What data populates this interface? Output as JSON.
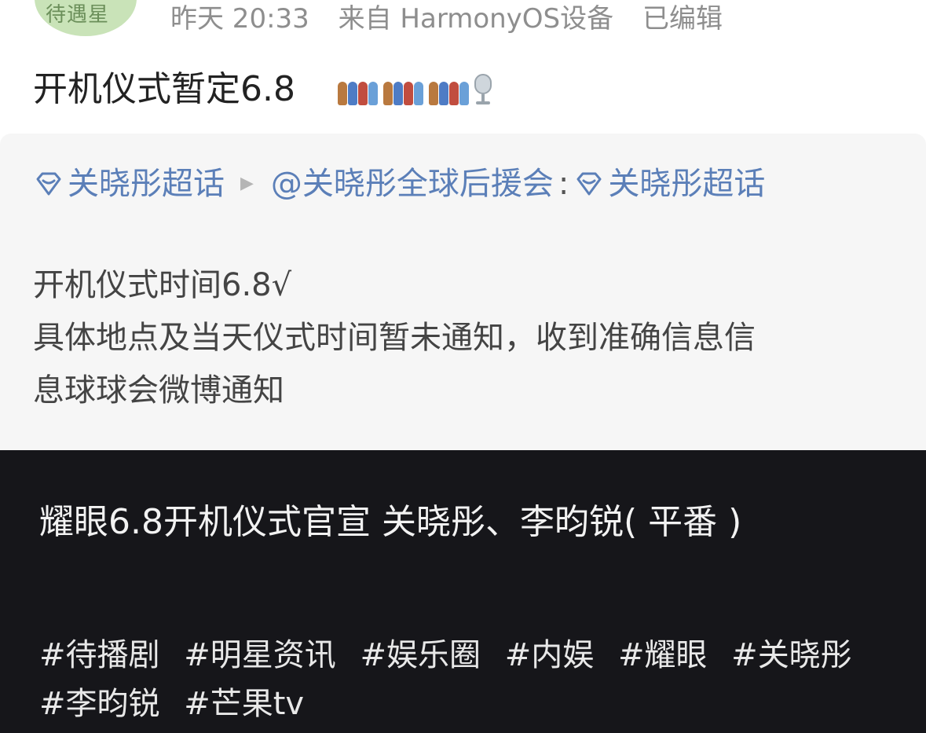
{
  "post": {
    "avatar_text": "待遇星",
    "time": "昨天 20:33",
    "source": "来自 HarmonyOS设备",
    "edited": "已编辑",
    "text": "开机仪式暂定6.8",
    "emojis": [
      "people-group-emoji",
      "people-group-emoji",
      "people-group-emoji",
      "microphone-emoji"
    ]
  },
  "repost": {
    "topic": "关晓彤超话",
    "author": "@关晓彤全球后援会",
    "colon": ":",
    "topic2": "关晓彤超话",
    "lines": [
      "开机仪式时间6.8√",
      "具体地点及当天仪式时间暂未通知，收到准确信息信",
      "息球球会微博通知"
    ]
  },
  "video": {
    "title": "耀眼6.8开机仪式官宣 关晓彤、李昀锐( 平番 )",
    "tags": [
      "#待播剧",
      "#明星资讯",
      "#娱乐圈",
      "#内娱",
      "#耀眼",
      "#关晓彤",
      "#李昀锐",
      "#芒果tv"
    ]
  },
  "colors": {
    "link": "#5b7fb8",
    "meta": "#8e8e8e",
    "video_bg": "#16161a"
  }
}
